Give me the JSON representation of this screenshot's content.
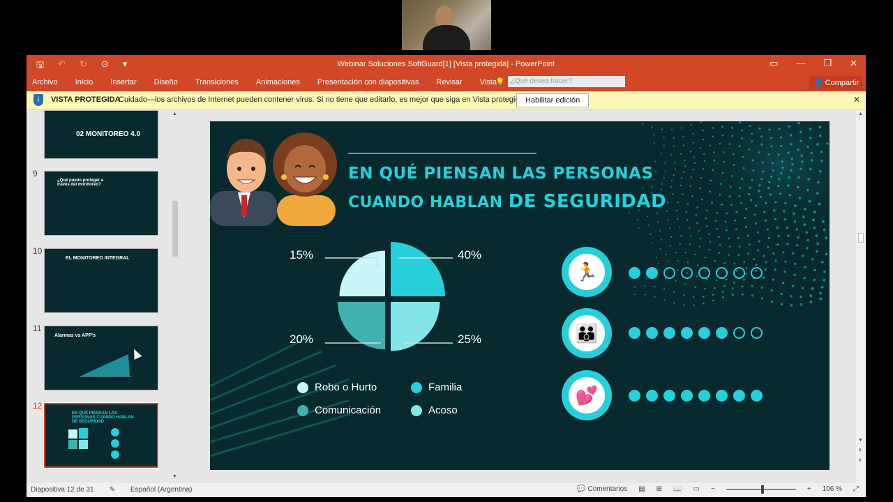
{
  "window": {
    "title": "Webinar Soluciones SoftGuard[1] [Vista protegida] - PowerPoint",
    "qat_icons": [
      "save-icon",
      "undo-icon",
      "redo-icon",
      "present-icon",
      "customize-icon"
    ]
  },
  "ribbon": {
    "tabs": [
      "Archivo",
      "Inicio",
      "Insertar",
      "Diseño",
      "Transiciones",
      "Animaciones",
      "Presentación con diapositivas",
      "Revisar",
      "Vista"
    ],
    "search_placeholder": "¿Qué desea hacer?",
    "share_label": "Compartir"
  },
  "protected_bar": {
    "label": "VISTA PROTEGIDA",
    "message": "Cuidado—los archivos de Internet pueden contener virus. Si no tiene que editarlo, es mejor que siga en Vista protegida.",
    "enable_label": "Habilitar edición"
  },
  "thumbnails": [
    {
      "num": "",
      "title": "02 MONITOREO 4.0"
    },
    {
      "num": "9",
      "title": "¿Qué puedo proteger a través del monitoreo?"
    },
    {
      "num": "10",
      "title": "EL MONITOREO INTEGRAL"
    },
    {
      "num": "11",
      "title": "Alarmas vs APP's"
    },
    {
      "num": "12",
      "title": "EN QUÉ PIENSAN LAS PERSONAS CUANDO HABLAN DE SEGURIDAD"
    }
  ],
  "slide": {
    "headline_1": "EN QUÉ PIENSAN LAS PERSONAS",
    "headline_2a": "CUANDO HABLAN ",
    "headline_2b": "DE SEGURIDAD",
    "percent_labels": [
      "15%",
      "40%",
      "20%",
      "25%"
    ],
    "legend": [
      {
        "label": "Robo o Hurto",
        "color": "#c9f5f8"
      },
      {
        "label": "Familia",
        "color": "#25d0da"
      },
      {
        "label": "Comunicación",
        "color": "#3fb2b0"
      },
      {
        "label": "Acoso",
        "color": "#82e6e8"
      }
    ],
    "ratings": [
      {
        "icon": "thief-icon",
        "filled": 2,
        "total": 8
      },
      {
        "icon": "family-icon",
        "filled": 6,
        "total": 8
      },
      {
        "icon": "heart-family-icon",
        "filled": 8,
        "total": 8
      }
    ]
  },
  "chart_data": {
    "type": "pie",
    "categories": [
      "Robo o Hurto",
      "Familia",
      "Comunicación",
      "Acoso"
    ],
    "values": [
      15,
      40,
      20,
      25
    ],
    "colors": [
      "#c9f5f8",
      "#25d0da",
      "#3fb2b0",
      "#82e6e8"
    ]
  },
  "status": {
    "slide_info": "Diapositiva 12 de 31",
    "language": "Español (Argentina)",
    "comments_label": "Comentarios",
    "zoom": "106 %"
  },
  "colors": {
    "accent": "#d24726",
    "slide_bg": "#082a2e",
    "cyan": "#25d0da"
  }
}
